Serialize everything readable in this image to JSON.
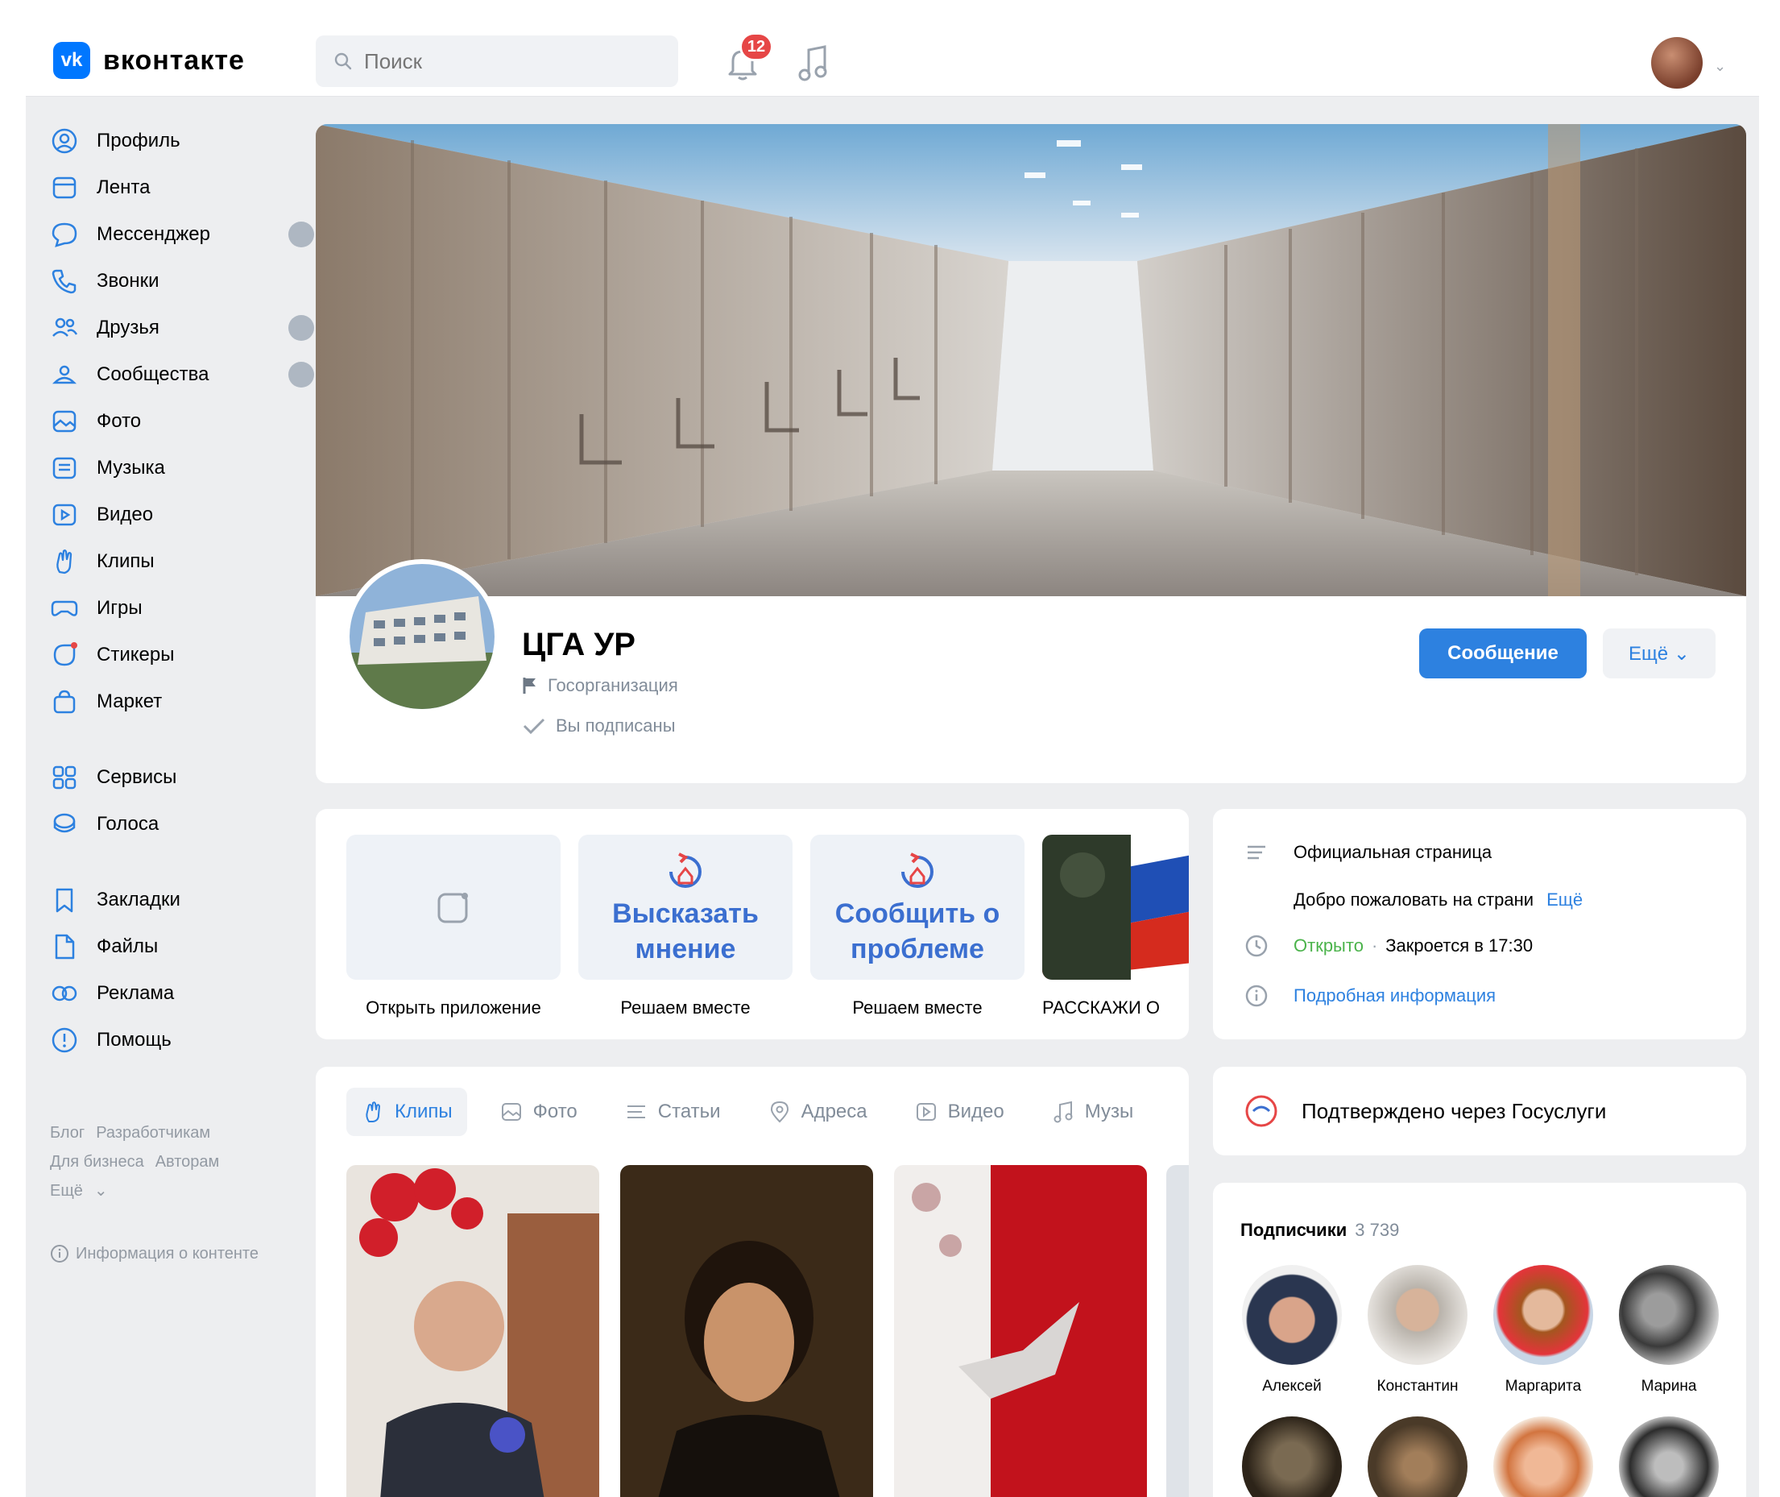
{
  "header": {
    "logo_mark": "vk",
    "logo_text": "вконтакте",
    "search_placeholder": "Поиск",
    "notifications_count": "12"
  },
  "sidebar": {
    "items": [
      {
        "label": "Профиль",
        "icon": "profile-icon"
      },
      {
        "label": "Лента",
        "icon": "feed-icon"
      },
      {
        "label": "Мессенджер",
        "icon": "messenger-icon"
      },
      {
        "label": "Звонки",
        "icon": "phone-icon"
      },
      {
        "label": "Друзья",
        "icon": "friends-icon"
      },
      {
        "label": "Сообщества",
        "icon": "communities-icon"
      },
      {
        "label": "Фото",
        "icon": "photo-icon"
      },
      {
        "label": "Музыка",
        "icon": "music-icon"
      },
      {
        "label": "Видео",
        "icon": "video-icon"
      },
      {
        "label": "Клипы",
        "icon": "clips-icon"
      },
      {
        "label": "Игры",
        "icon": "games-icon"
      },
      {
        "label": "Стикеры",
        "icon": "stickers-icon"
      },
      {
        "label": "Маркет",
        "icon": "market-icon"
      }
    ],
    "items2": [
      {
        "label": "Сервисы",
        "icon": "services-icon"
      },
      {
        "label": "Голоса",
        "icon": "votes-icon"
      }
    ],
    "items3": [
      {
        "label": "Закладки",
        "icon": "bookmark-icon"
      },
      {
        "label": "Файлы",
        "icon": "files-icon"
      },
      {
        "label": "Реклама",
        "icon": "ads-icon"
      },
      {
        "label": "Помощь",
        "icon": "help-icon"
      }
    ],
    "footer": {
      "blog": "Блог",
      "developers": "Разработчикам",
      "business": "Для бизнеса",
      "authors": "Авторам",
      "more": "Ещё"
    },
    "info": "Информация о контенте"
  },
  "group": {
    "name": "ЦГА УР",
    "type": "Госорганизация",
    "subscribed": "Вы подписаны",
    "message_button": "Сообщение",
    "more_button": "Ещё"
  },
  "apps": [
    {
      "title": "",
      "caption": "Открыть приложение"
    },
    {
      "title": "Высказать мнение",
      "caption": "Решаем вместе"
    },
    {
      "title": "Сообщить о проблеме",
      "caption": "Решаем вместе"
    },
    {
      "title": "",
      "caption": "РАССКАЖИ О"
    }
  ],
  "info": {
    "official": "Официальная страница",
    "welcome": "Добро пожаловать на страни",
    "welcome_more": "Ещё",
    "open": "Открыто",
    "closes": "Закроется в 17:30",
    "details": "Подробная информация"
  },
  "gosuslugi": "Подтверждено через Госуслуги",
  "tabs": [
    {
      "label": "Клипы",
      "icon": "clips-icon"
    },
    {
      "label": "Фото",
      "icon": "photo-icon"
    },
    {
      "label": "Статьи",
      "icon": "articles-icon"
    },
    {
      "label": "Адреса",
      "icon": "location-icon"
    },
    {
      "label": "Видео",
      "icon": "video-icon"
    },
    {
      "label": "Музы",
      "icon": "music-icon"
    }
  ],
  "subscribers": {
    "title": "Подписчики",
    "count": "3 739",
    "people": [
      {
        "name": "Алексей"
      },
      {
        "name": "Константин"
      },
      {
        "name": "Маргарита"
      },
      {
        "name": "Марина"
      }
    ]
  },
  "colors": {
    "accent": "#2d81e0",
    "brand": "#0077ff",
    "badge": "#e64646"
  }
}
